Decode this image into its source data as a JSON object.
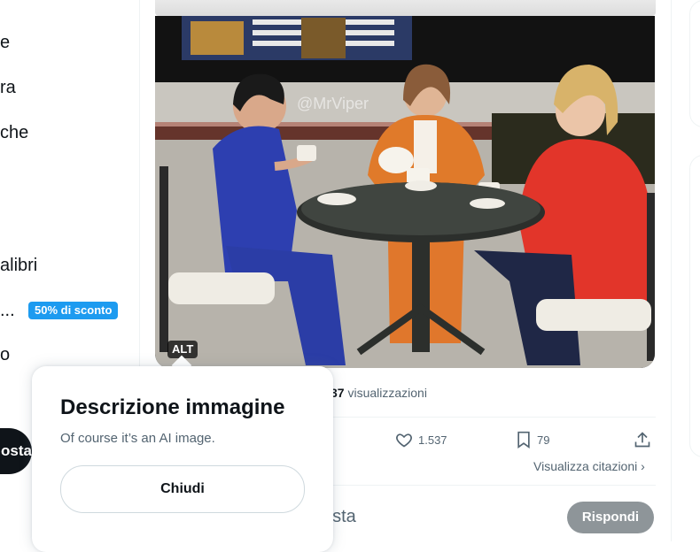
{
  "nav": {
    "items": [
      "e",
      "ra",
      "che",
      "alibri",
      "...",
      "o"
    ],
    "promo_badge": "50% di sconto",
    "post_button": "osta"
  },
  "media": {
    "watermark": "@MrViper",
    "alt_badge": "ALT"
  },
  "stats": {
    "views_count": "37",
    "views_label": "visualizzazioni"
  },
  "actions": {
    "likes": "1.537",
    "bookmarks": "79",
    "likes_icon": "heart-icon",
    "bookmark_icon": "bookmark-icon",
    "share_icon": "share-icon"
  },
  "quotes_link": "Visualizza citazioni ›",
  "reply": {
    "placeholder": "osta",
    "button": "Rispondi"
  },
  "popup": {
    "title": "Descrizione immagine",
    "text": "Of course it’s an AI image.",
    "close": "Chiudi"
  },
  "colors": {
    "accent": "#1d9bf0",
    "text": "#0f1419",
    "muted": "#536471"
  }
}
